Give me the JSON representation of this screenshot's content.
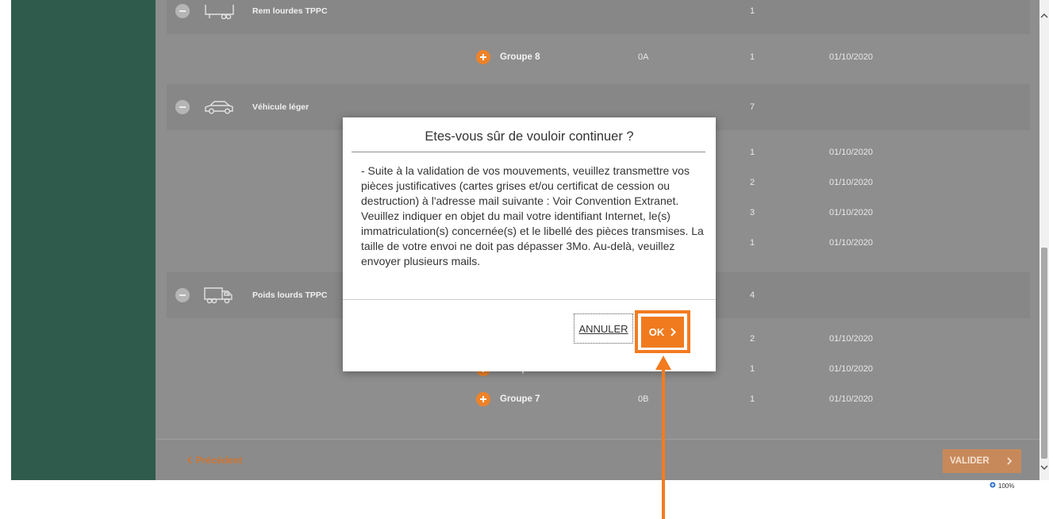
{
  "colors": {
    "sidebar": "#2e5b4c",
    "content_background": "#8e8e8e",
    "accent": "#f07b1e",
    "annotation": "#f37b20"
  },
  "groups": [
    {
      "label": "Rem lourdes TPPC",
      "icon": "trailer-icon",
      "count": "1",
      "rows": [
        {
          "name": "Groupe 8",
          "code": "0A",
          "count": "1",
          "date": "01/10/2020"
        }
      ]
    },
    {
      "label": "Véhicule léger",
      "icon": "car-icon",
      "count": "7",
      "rows": [
        {
          "count": "1",
          "date": "01/10/2020"
        },
        {
          "count": "2",
          "date": "01/10/2020"
        },
        {
          "count": "3",
          "date": "01/10/2020"
        },
        {
          "count": "1",
          "date": "01/10/2020"
        }
      ]
    },
    {
      "label": "Poids lourds TPPC",
      "icon": "truck-icon",
      "count": "4",
      "rows": [
        {
          "count": "2",
          "date": "01/10/2020"
        },
        {
          "name": "Groupe",
          "count": "1",
          "date": "01/10/2020"
        },
        {
          "name": "Groupe 7",
          "code": "0B",
          "count": "1",
          "date": "01/10/2020"
        }
      ]
    }
  ],
  "footer": {
    "previous_label": "Précédent",
    "validate_label": "VALIDER"
  },
  "modal": {
    "title": "Etes-vous sûr de vouloir continuer ?",
    "message_lines": [
      "- Suite à la validation de vos mouvements, veuillez transmettre vos",
      "pièces justificatives (cartes grises et/ou certificat de cession ou",
      "destruction) à l'adresse mail suivante : Voir Convention Extranet.",
      "Veuillez indiquer en objet du mail votre identifiant Internet, le(s)",
      "immatriculation(s) concernée(s) et le libellé des pièces transmises. La",
      "taille de votre envoi ne doit pas dépasser 3Mo. Au-delà, veuillez",
      "envoyer plusieurs mails."
    ],
    "cancel_label": "ANNULER",
    "ok_label": "OK"
  },
  "status_bar": {
    "zoom": "100%"
  }
}
